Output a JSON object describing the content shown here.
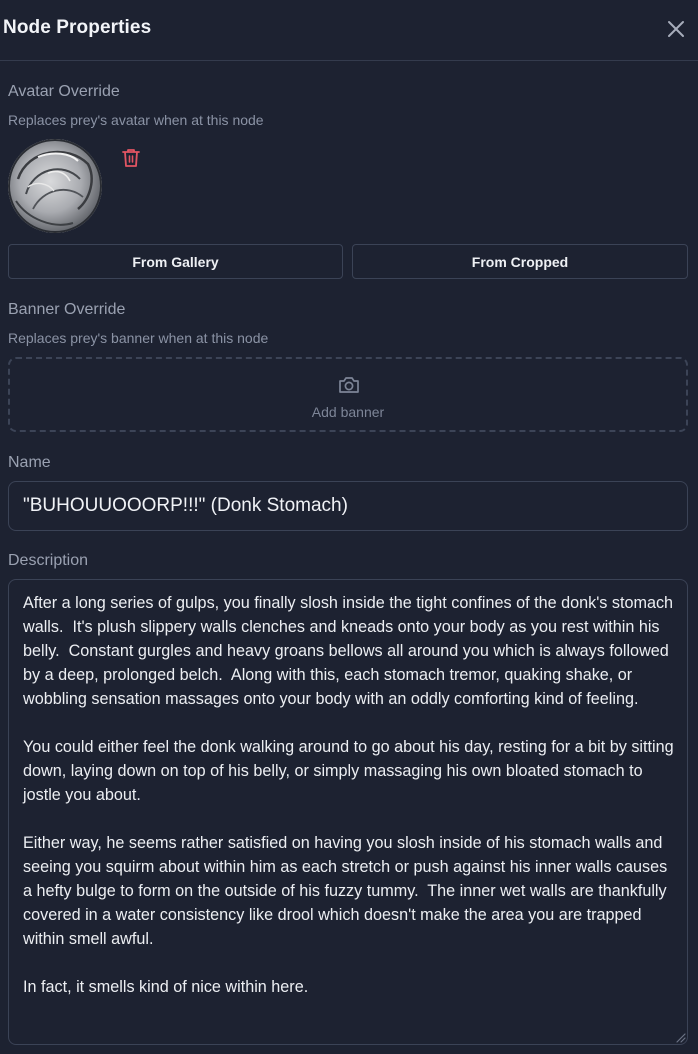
{
  "header": {
    "title": "Node Properties",
    "close_icon": "close-icon"
  },
  "avatar_override": {
    "label": "Avatar Override",
    "subtitle": "Replaces prey's avatar when at this node",
    "delete_icon": "trash-icon",
    "from_gallery_label": "From Gallery",
    "from_cropped_label": "From Cropped"
  },
  "banner_override": {
    "label": "Banner Override",
    "subtitle": "Replaces prey's banner when at this node",
    "camera_icon": "camera-icon",
    "add_label": "Add banner"
  },
  "name": {
    "label": "Name",
    "value": "\"BUHOUUOOORP!!!\" (Donk Stomach)"
  },
  "description": {
    "label": "Description",
    "value": "After a long series of gulps, you finally slosh inside the tight confines of the donk's stomach walls.  It's plush slippery walls clenches and kneads onto your body as you rest within his belly.  Constant gurgles and heavy groans bellows all around you which is always followed by a deep, prolonged belch.  Along with this, each stomach tremor, quaking shake, or wobbling sensation massages onto your body with an oddly comforting kind of feeling.\n\nYou could either feel the donk walking around to go about his day, resting for a bit by sitting down, laying down on top of his belly, or simply massaging his own bloated stomach to jostle you about.\n\nEither way, he seems rather satisfied on having you slosh inside of his stomach walls and seeing you squirm about within him as each stretch or push against his inner walls causes a hefty bulge to form on the outside of his fuzzy tummy.  The inner wet walls are thankfully covered in a water consistency like drool which doesn't make the area you are trapped within smell awful.\n\nIn fact, it smells kind of nice within here."
  },
  "colors": {
    "background": "#1d2231",
    "border": "#3b4356",
    "danger": "#e25563",
    "muted_text": "#9aa1b1"
  }
}
